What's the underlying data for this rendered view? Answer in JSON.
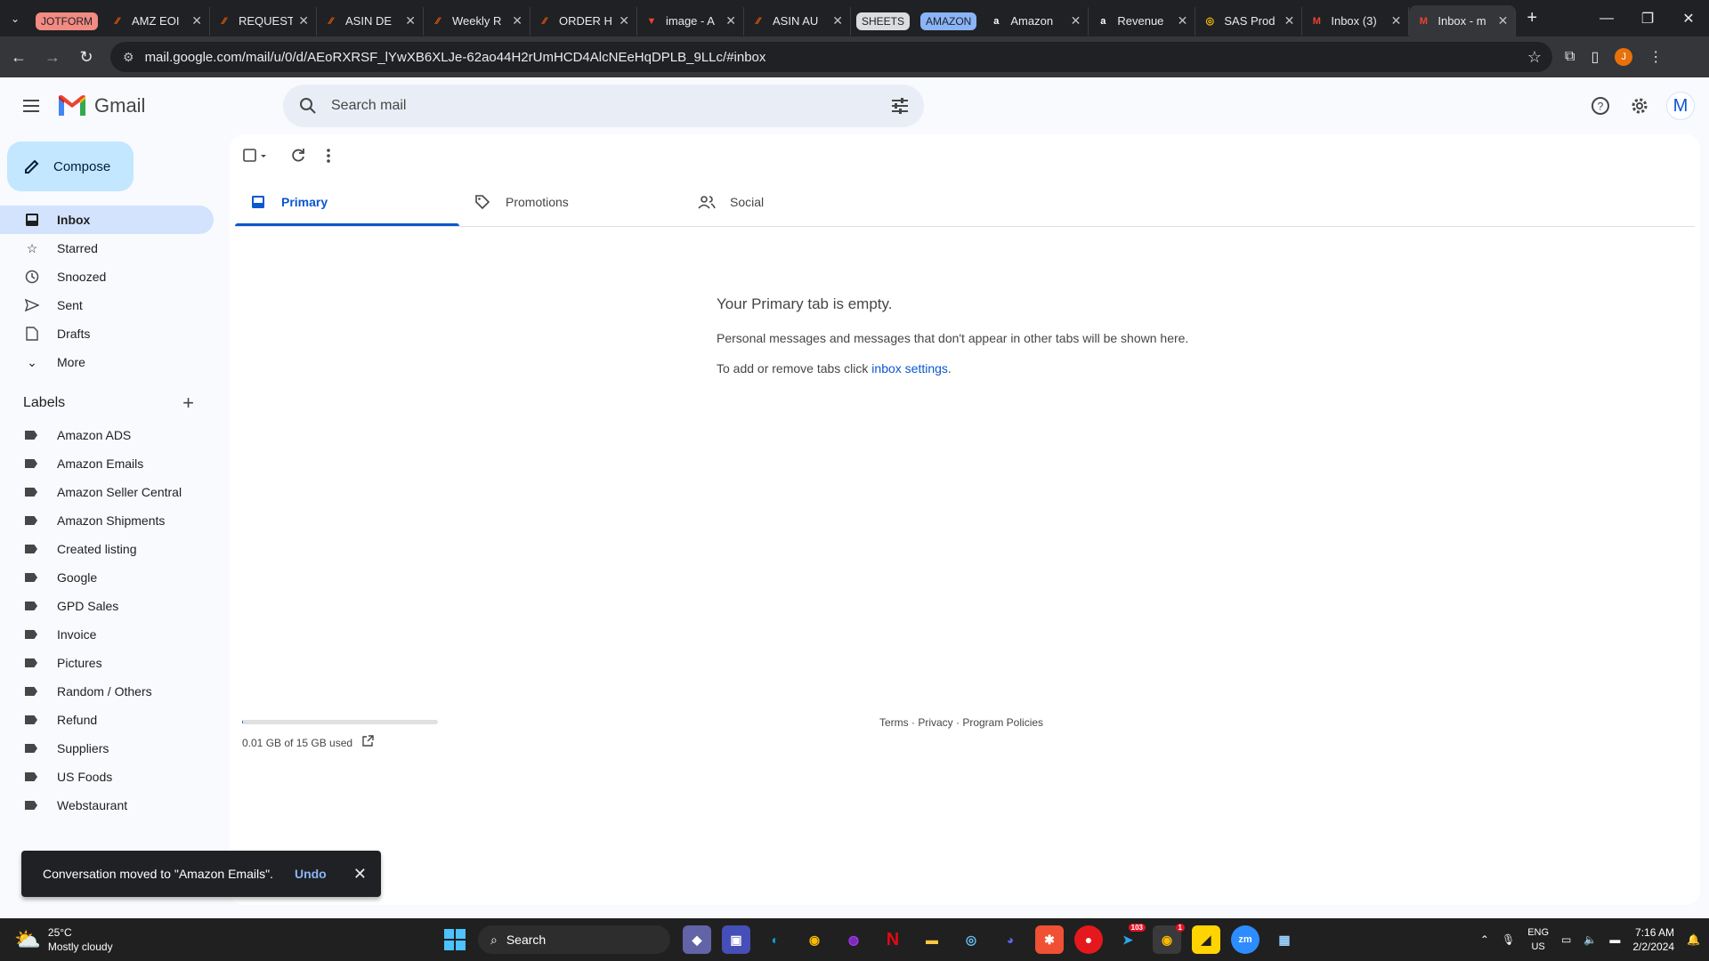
{
  "browser": {
    "tab_groups": [
      {
        "label": "JOTFORM",
        "color": "#f28b82",
        "text": "#202124"
      },
      {
        "label": "SHEETS",
        "color": "#dadce0",
        "text": "#202124"
      },
      {
        "label": "AMAZON",
        "color": "#8ab4f8",
        "text": "#202124"
      }
    ],
    "tabs": [
      {
        "title": "AMZ EOI",
        "icon": "jotform-icon"
      },
      {
        "title": "REQUEST",
        "icon": "jotform-icon"
      },
      {
        "title": "ASIN DE",
        "icon": "jotform-icon"
      },
      {
        "title": "Weekly R",
        "icon": "jotform-icon"
      },
      {
        "title": "ORDER H",
        "icon": "jotform-icon"
      },
      {
        "title": "image - A",
        "icon": "red-icon"
      },
      {
        "title": "ASIN AU",
        "icon": "jotform-icon"
      },
      {
        "title": "Amazon",
        "icon": "amazon-icon"
      },
      {
        "title": "Revenue",
        "icon": "amazon-icon"
      },
      {
        "title": "SAS Prod",
        "icon": "sas-icon"
      },
      {
        "title": "Inbox (3)",
        "icon": "gmail-icon"
      },
      {
        "title": "Inbox - m",
        "icon": "gmail-icon"
      }
    ],
    "url": "mail.google.com/mail/u/0/d/AEoRXRSF_lYwXB6XLJe-62ao44H2rUmHCD4AlcNEeHqDPLB_9LLc/#inbox",
    "profile_initial": "J"
  },
  "gmail": {
    "logo_text": "Gmail",
    "search_placeholder": "Search mail",
    "avatar_initial": "M",
    "compose_label": "Compose",
    "nav": [
      {
        "label": "Inbox",
        "icon": "inbox-icon",
        "active": true
      },
      {
        "label": "Starred",
        "icon": "star-icon"
      },
      {
        "label": "Snoozed",
        "icon": "clock-icon"
      },
      {
        "label": "Sent",
        "icon": "send-icon"
      },
      {
        "label": "Drafts",
        "icon": "draft-icon"
      },
      {
        "label": "More",
        "icon": "chevron-down-icon"
      }
    ],
    "labels_title": "Labels",
    "labels": [
      "Amazon ADS",
      "Amazon Emails",
      "Amazon Seller Central",
      "Amazon Shipments",
      "Created listing",
      "Google",
      "GPD Sales",
      "Invoice",
      "Pictures",
      "Random / Others",
      "Refund",
      "Suppliers",
      "US Foods",
      "Webstaurant"
    ],
    "category_tabs": [
      {
        "label": "Primary",
        "icon": "inbox-icon",
        "active": true
      },
      {
        "label": "Promotions",
        "icon": "tag-icon"
      },
      {
        "label": "Social",
        "icon": "people-icon"
      }
    ],
    "empty": {
      "title": "Your Primary tab is empty.",
      "line1": "Personal messages and messages that don't appear in other tabs will be shown here.",
      "line2_prefix": "To add or remove tabs click ",
      "line2_link": "inbox settings",
      "line2_suffix": "."
    },
    "storage": {
      "text": "0.01 GB of 15 GB used",
      "fraction": 0.001
    },
    "footer": "Terms · Privacy · Program Policies",
    "toast": {
      "message": "Conversation moved to \"Amazon Emails\".",
      "action": "Undo"
    }
  },
  "taskbar": {
    "temp": "25°C",
    "weather": "Mostly cloudy",
    "search_label": "Search",
    "lang_top": "ENG",
    "lang_bottom": "US",
    "time": "7:16 AM",
    "date": "2/2/2024",
    "telegram_badge": "103",
    "chrome_badge": "1"
  }
}
